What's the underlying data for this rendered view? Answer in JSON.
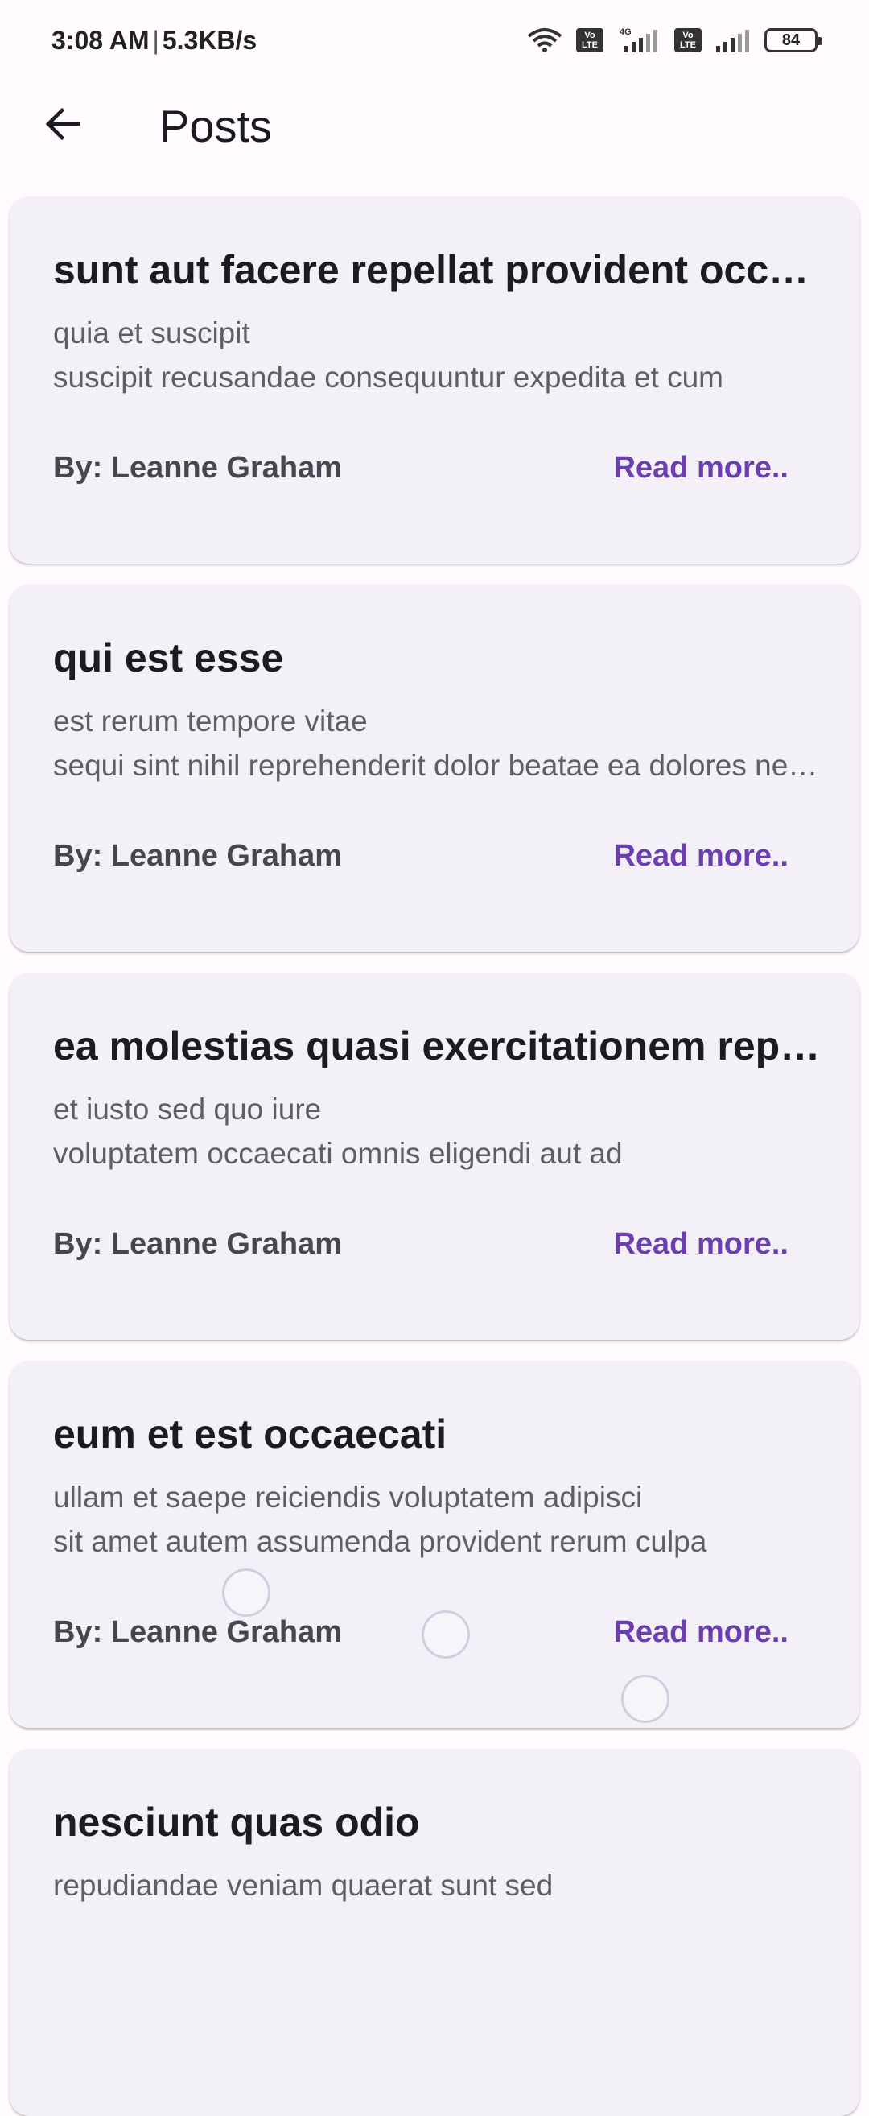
{
  "status_bar": {
    "time": "3:08 AM",
    "separator": "|",
    "speed": "5.3KB/s",
    "network_label": "4G",
    "volte_label": "Vo LTE",
    "battery": "84"
  },
  "app_bar": {
    "title": "Posts"
  },
  "colors": {
    "accent": "#6b3fb0",
    "card_bg": "#f4f0f8",
    "page_bg": "#fffbfe"
  },
  "posts": [
    {
      "title": "sunt aut facere repellat provident occaecati excepturi optio reprehenderit",
      "body_line1": "quia et suscipit",
      "body_line2": "suscipit recusandae consequuntur expedita et cum",
      "author": "By: Leanne Graham",
      "read_more": "Read more.."
    },
    {
      "title": "qui est esse",
      "body_line1": "est rerum tempore vitae",
      "body_line2": "sequi sint nihil reprehenderit dolor beatae ea dolores neque",
      "author": "By: Leanne Graham",
      "read_more": "Read more.."
    },
    {
      "title": "ea molestias quasi exercitationem repellat qui ipsa sit aut",
      "body_line1": "et iusto sed quo iure",
      "body_line2": "voluptatem occaecati omnis eligendi aut ad",
      "author": "By: Leanne Graham",
      "read_more": "Read more.."
    },
    {
      "title": "eum et est occaecati",
      "body_line1": "ullam et saepe reiciendis voluptatem adipisci",
      "body_line2": "sit amet autem assumenda provident rerum culpa",
      "author": "By: Leanne Graham",
      "read_more": "Read more.."
    },
    {
      "title": "nesciunt quas odio",
      "body_line1": "repudiandae veniam quaerat sunt sed",
      "body_line2": "",
      "author": "",
      "read_more": ""
    }
  ]
}
